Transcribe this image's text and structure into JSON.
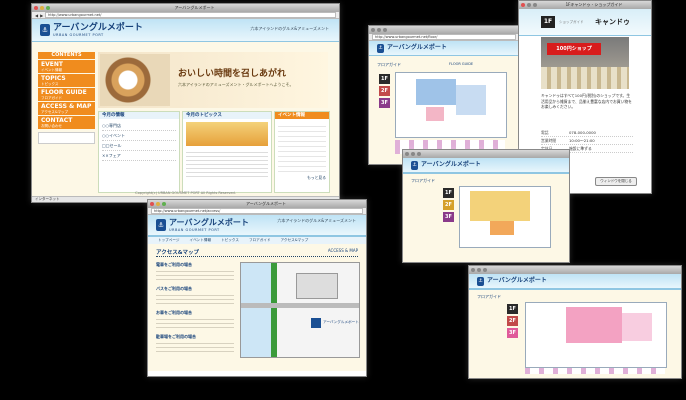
{
  "main_window": {
    "title": "アーバングルメポート",
    "url": "http://www.urbangourmet.net/",
    "logo_jp": "アーバングルメポート",
    "logo_en": "URBAN GOURMET PORT",
    "tagline": "六本アイランドのグルメ&アミューズメント",
    "menu_header": "CONTENTS",
    "menu": [
      {
        "label": "EVENT",
        "sub": "イベント情報"
      },
      {
        "label": "TOPICS",
        "sub": "トピックス"
      },
      {
        "label": "FLOOR GUIDE",
        "sub": "フロアガイド"
      },
      {
        "label": "ACCESS & MAP",
        "sub": "アクセス&マップ"
      },
      {
        "label": "CONTACT",
        "sub": "お問い合わせ"
      }
    ],
    "hero_text": "おいしい時間を召しあがれ",
    "hero_sub": "六本アイランドのアミューズメント・グルメポートへようこそ。",
    "news_title": "今月の情報",
    "topics_title": "今月のトピックス",
    "event_title": "イベント情報",
    "more_label": "もっと見る",
    "news_items": [
      "○○専門店",
      "○○イベント",
      "□□セール",
      "××フェア"
    ],
    "copyright": "Copyright(c) URBAN GOURMET PORT All Rights Reserved.",
    "status": "インターネット"
  },
  "access_window": {
    "title": "アーバングルメポート",
    "url": "http://www.urbangourmet.net/access/",
    "logo_jp": "アーバングルメポート",
    "logo_en": "URBAN GOURMET PORT",
    "tagline": "六本アイランドのグルメ&アミューズメント",
    "nav": [
      "トップページ",
      "イベント情報",
      "トピックス",
      "フロアガイド",
      "アクセス&マップ"
    ],
    "page_title": "アクセス&マップ",
    "page_title_en": "ACCESS & MAP",
    "sections": [
      "電車をご利用の場合",
      "バスをご利用の場合",
      "お車をご利用の場合",
      "駐車場をご利用の場合"
    ],
    "map_label": "アーバングルメポート"
  },
  "floor_window_1": {
    "url": "http://www.urbangourmet.net/floor/",
    "logo_jp": "アーバングルメポート",
    "page_title": "フロアガイド",
    "page_title_en": "FLOOR GUIDE",
    "floors": [
      "1F",
      "2F",
      "3F"
    ]
  },
  "floor_window_2": {
    "logo_jp": "アーバングルメポート",
    "page_title": "フロアガイド",
    "floors": [
      "1F",
      "2F",
      "3F"
    ]
  },
  "floor_window_3": {
    "logo_jp": "アーバングルメポート",
    "page_title": "フロアガイド",
    "floors": [
      "1F",
      "2F",
      "3F"
    ]
  },
  "shop_window": {
    "title": "1Fキャンドゥ - ショップガイド",
    "floor": "1F",
    "category": "ショップガイド",
    "shop_name": "キャンドゥ",
    "sign_text": "100円ショップ",
    "description": "キャンドゥはすべて100円(税別)のショップです。生活用品から雑貨まで、品揃え豊富な店内でお買い物をお楽しみください。",
    "info": [
      {
        "k": "電話",
        "v": "078-000-0000"
      },
      {
        "k": "営業時間",
        "v": "10:00～21:00"
      },
      {
        "k": "定休日",
        "v": "施設に準ずる"
      }
    ],
    "close_label": "ウィンドウを閉じる"
  },
  "colors": {
    "orange": "#f08c1e",
    "navy": "#1a4f93",
    "sky": "#bfe3f5",
    "cream": "#fdf8e6",
    "shopred": "#d81c1c"
  }
}
